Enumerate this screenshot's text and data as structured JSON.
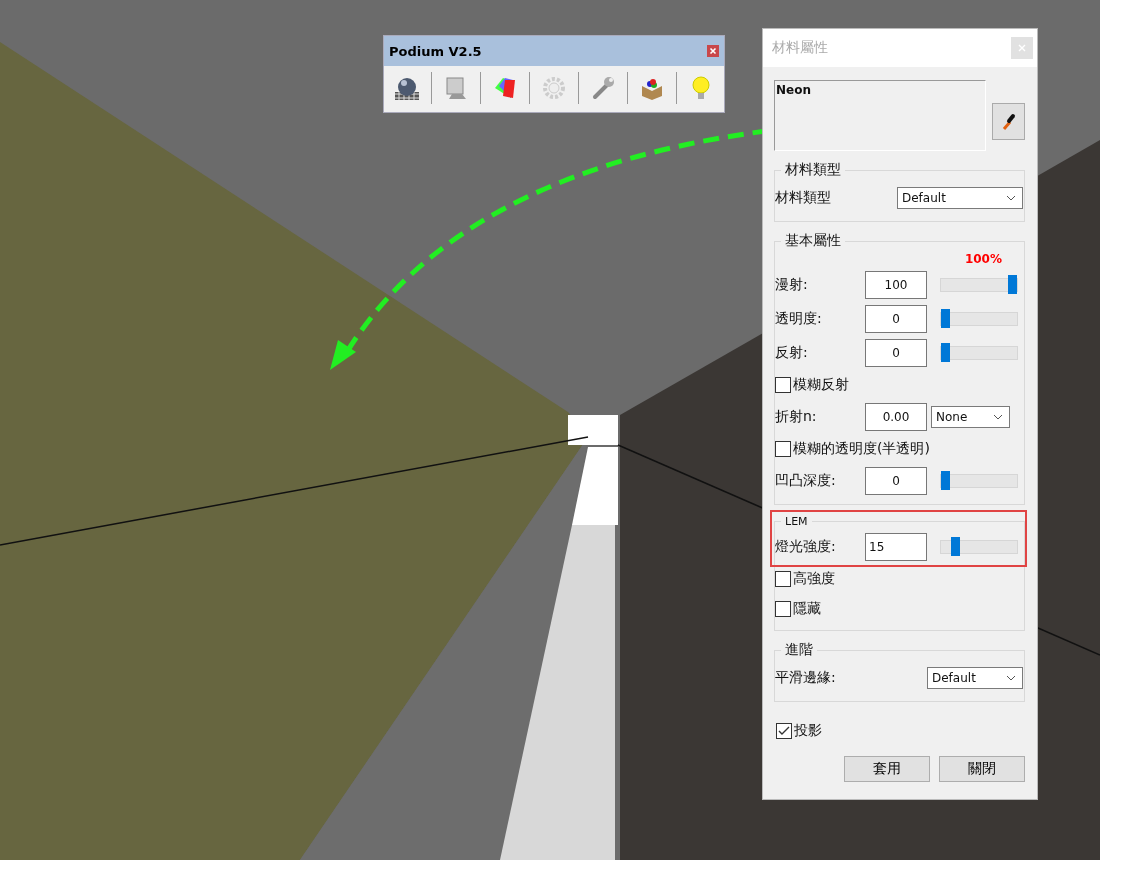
{
  "toolbar": {
    "title": "Podium V2.5"
  },
  "dialog": {
    "title": "材料屬性",
    "material_name": "Neon",
    "material_type": {
      "legend": "材料類型",
      "label": "材料類型",
      "value": "Default"
    },
    "basic": {
      "legend": "基本屬性",
      "percent": "100%",
      "sliders": [
        {
          "label": "漫射:",
          "value": "100",
          "level": 1
        },
        {
          "label": "透明度:",
          "value": "0",
          "level": 0
        },
        {
          "label": "反射:",
          "value": "0",
          "level": 0
        }
      ],
      "blur_reflection": {
        "label": "模糊反射",
        "checked": false
      },
      "refraction": {
        "label": "折射n:",
        "value": "0.00",
        "mode": "None"
      },
      "blur_transparency": {
        "label": "模糊的透明度(半透明)",
        "checked": false
      },
      "bump": {
        "label": "凹凸深度:",
        "value": "0",
        "level": 0
      }
    },
    "lem": {
      "legend": "LEM",
      "label": "燈光強度:",
      "value": "15",
      "level": 0.15,
      "checks": [
        {
          "label": "高強度",
          "checked": false
        },
        {
          "label": "隱藏",
          "checked": false
        }
      ]
    },
    "advanced": {
      "legend": "進階",
      "label": "平滑邊緣:",
      "value": "Default"
    },
    "shadow": {
      "label": "投影",
      "checked": true
    },
    "buttons": [
      "套用",
      "關閉"
    ]
  }
}
